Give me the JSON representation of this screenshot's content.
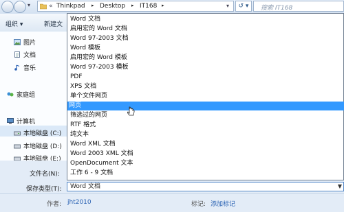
{
  "address_bar": {
    "prefix": "«",
    "crumbs": [
      "Thinkpad",
      "Desktop",
      "IT168"
    ],
    "separator": "▸",
    "refresh_label": "↺ ▾"
  },
  "search": {
    "placeholder": "搜索 IT168"
  },
  "toolbar": {
    "organize_label": "组织 ▾",
    "new_folder_label": "新建文"
  },
  "nav_pane": {
    "items": [
      {
        "label": "图片",
        "icon": "picture-icon"
      },
      {
        "label": "文档",
        "icon": "document-icon"
      },
      {
        "label": "音乐",
        "icon": "music-icon"
      },
      {
        "label": "家庭组",
        "icon": "homegroup-icon"
      },
      {
        "label": "计算机",
        "icon": "computer-icon"
      },
      {
        "label": "本地磁盘 (C:)",
        "icon": "drive-icon",
        "selected": true
      },
      {
        "label": "本地磁盘 (D:)",
        "icon": "drive-icon"
      },
      {
        "label": "本地磁盘 (E:)",
        "icon": "drive-icon"
      }
    ]
  },
  "save_type_dropdown": {
    "options": [
      "Word 文档",
      "启用宏的 Word 文档",
      "Word 97-2003 文档",
      "Word 模板",
      "启用宏的 Word 模板",
      "Word 97-2003 模板",
      "PDF",
      "XPS 文档",
      "单个文件网页",
      "网页",
      "筛选过的网页",
      "RTF 格式",
      "纯文本",
      "Word XML 文档",
      "Word 2003 XML 文档",
      "OpenDocument 文本",
      "工作 6 - 9 文档"
    ],
    "highlighted": "网页"
  },
  "form": {
    "filename_label": "文件名(N):",
    "filetype_label": "保存类型(T):",
    "filetype_value": "Word 文档"
  },
  "meta": {
    "author_label": "作者:",
    "author_value": "jht2010",
    "tags_label": "标记:",
    "tags_value": "添加标记"
  },
  "colors": {
    "highlight": "#3399ff",
    "link": "#2a62b3"
  }
}
